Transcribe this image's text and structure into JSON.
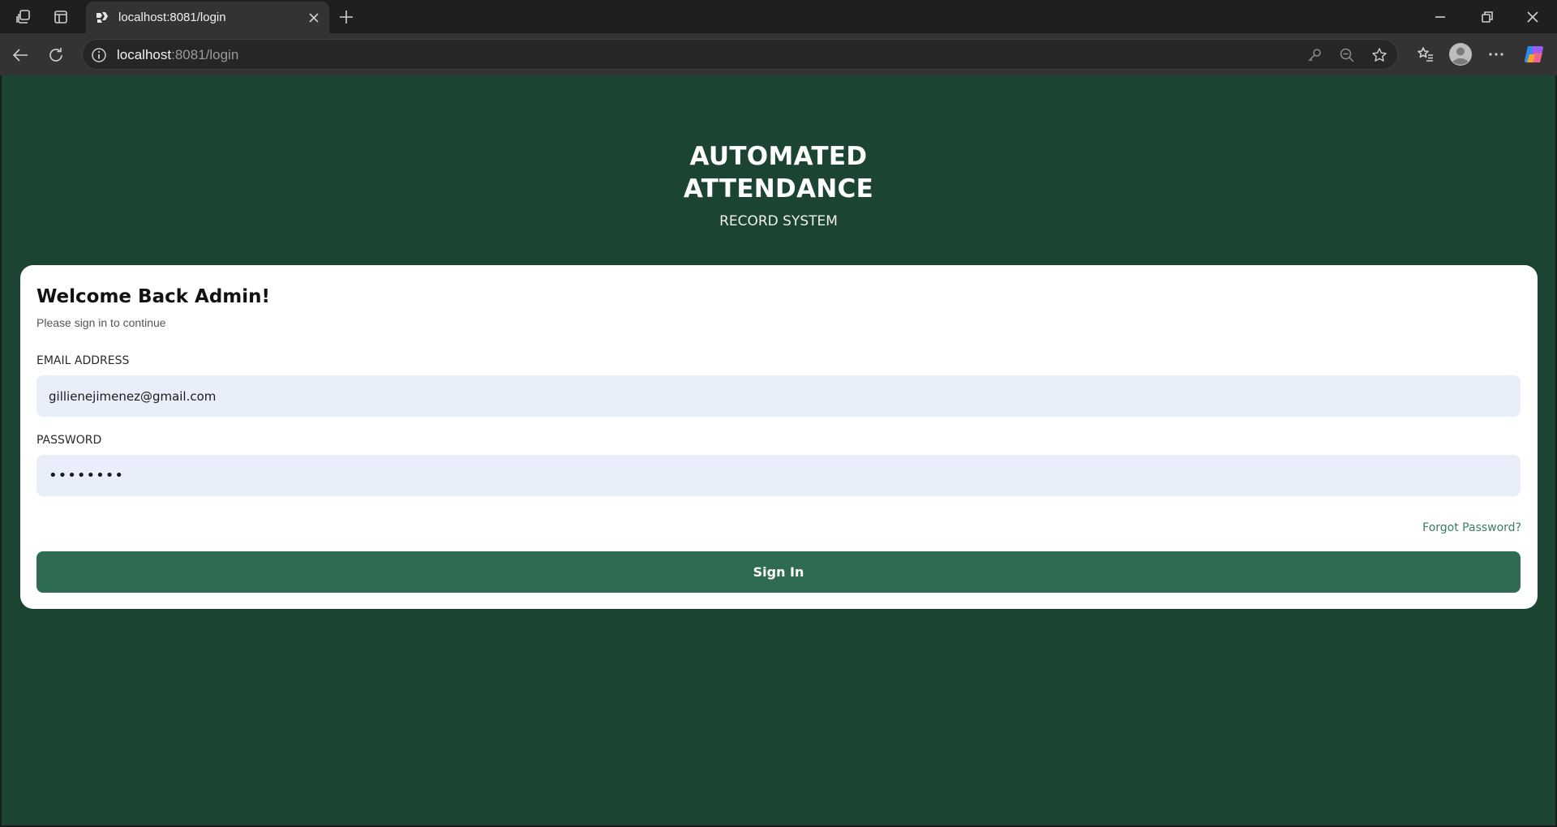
{
  "browser": {
    "tab": {
      "title": "localhost:8081/login"
    },
    "address_bar": {
      "host": "localhost",
      "path": ":8081/login"
    }
  },
  "page": {
    "brand": {
      "title_line1": "AUTOMATED",
      "title_line2": "ATTENDANCE",
      "subtitle": "RECORD SYSTEM"
    },
    "login": {
      "heading": "Welcome Back Admin!",
      "subtext": "Please sign in to continue",
      "email_label": "EMAIL ADDRESS",
      "email_value": "gillienejimenez@gmail.com",
      "password_label": "PASSWORD",
      "password_value": "••••••••",
      "forgot_label": "Forgot Password?",
      "submit_label": "Sign In"
    }
  },
  "colors": {
    "page_background": "#1c4433",
    "card_background": "#ffffff",
    "input_background": "#e8effb",
    "button_background": "#2f6b52",
    "link_color": "#3a7d5e"
  },
  "icons": [
    "workspaces-icon",
    "vertical-tabs-icon",
    "tab-favicon",
    "tab-close-icon",
    "new-tab-icon",
    "minimize-icon",
    "restore-icon",
    "window-close-icon",
    "back-arrow-icon",
    "reload-icon",
    "site-info-icon",
    "key-icon",
    "zoom-out-icon",
    "star-icon",
    "favorites-icon",
    "profile-icon",
    "more-icon",
    "copilot-icon"
  ]
}
